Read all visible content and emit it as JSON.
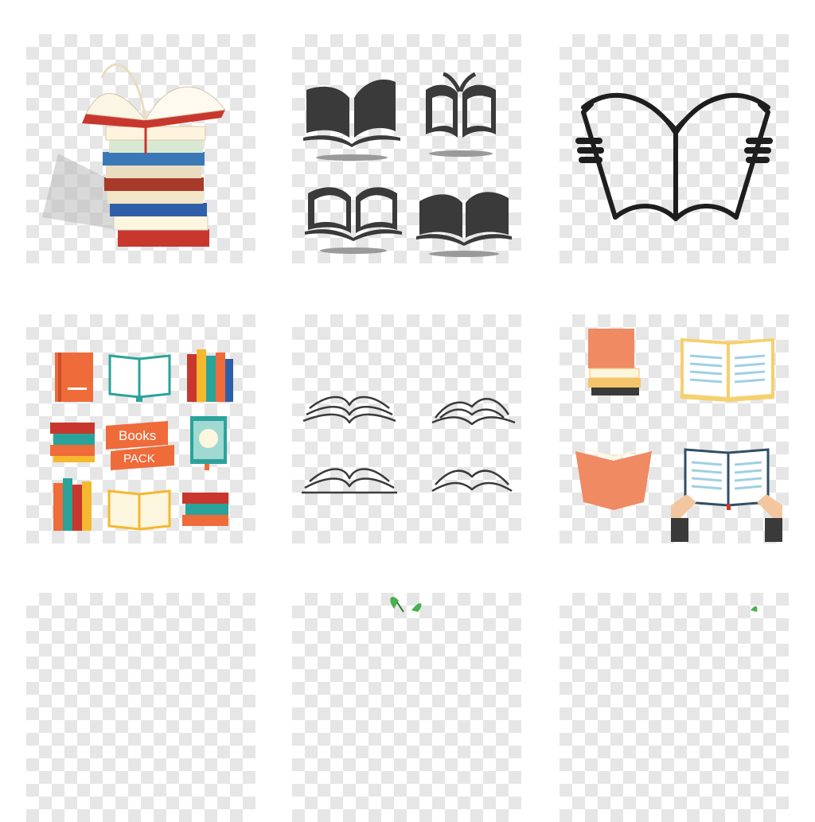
{
  "ribbon": {
    "line1": "Books",
    "line2": "PACK"
  },
  "colors": {
    "background": "#ffffff",
    "checker": "#e6e6e6",
    "silhouette": "#3a3a3a",
    "orange": "#ef6b3a",
    "teal": "#2aa39a",
    "cream": "#fdf6df",
    "red": "#c8372d"
  },
  "tiles": [
    {
      "icon": "book-stack-photo-icon"
    },
    {
      "icon": "open-book-silhouettes-icon"
    },
    {
      "icon": "reading-hands-book-icon"
    },
    {
      "icon": "flat-books-pack-icon"
    },
    {
      "icon": "outline-open-books-icon"
    },
    {
      "icon": "flat-reading-books-icon"
    },
    {
      "icon": "partial-tile-icon"
    },
    {
      "icon": "plant-sprout-icon"
    },
    {
      "icon": "partial-tile-icon"
    }
  ]
}
